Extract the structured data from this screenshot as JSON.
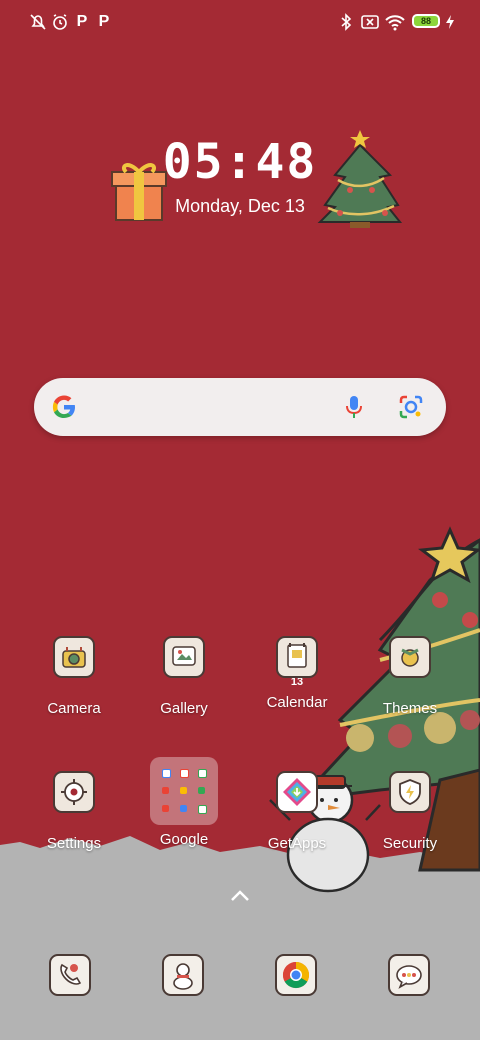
{
  "status": {
    "battery": "88",
    "icons": [
      "notification-off-icon",
      "alarm-icon",
      "parking-p-icon",
      "parking-p-icon",
      "bluetooth-icon",
      "no-sim-icon",
      "wifi-icon",
      "charging-bolt-icon"
    ]
  },
  "clock": {
    "time": "05:48",
    "date": "Monday, Dec 13"
  },
  "search": {
    "icons": [
      "google-g-icon",
      "microphone-icon",
      "lens-camera-icon"
    ]
  },
  "apps": [
    {
      "label": "Camera"
    },
    {
      "label": "Gallery"
    },
    {
      "label": "Calendar",
      "badge": "13"
    },
    {
      "label": "Themes"
    },
    {
      "label": "Settings"
    },
    {
      "label": "Google"
    },
    {
      "label": "GetApps"
    },
    {
      "label": "Security"
    }
  ],
  "dock": [
    "phone-app-icon",
    "contacts-app-icon",
    "chrome-icon",
    "messages-app-icon"
  ],
  "colors": {
    "wallpaper": "#a42a34",
    "snow": "#b3b3b3",
    "tree": "#4f7a55",
    "accent_gold": "#e9c24f"
  }
}
